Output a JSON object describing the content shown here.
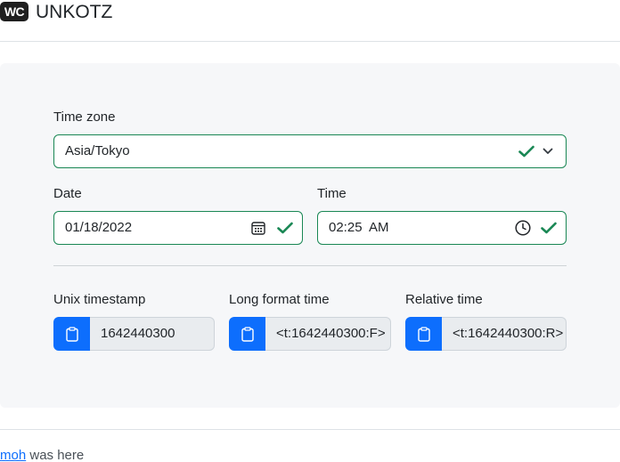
{
  "header": {
    "logo_text": "WC",
    "brand_name": "UNKOTZ"
  },
  "form": {
    "timezone": {
      "label": "Time zone",
      "value": "Asia/Tokyo"
    },
    "date": {
      "label": "Date",
      "value": "01/18/2022"
    },
    "time": {
      "label": "Time",
      "value": "02:25  AM"
    }
  },
  "outputs": [
    {
      "label": "Unix timestamp",
      "value": "1642440300"
    },
    {
      "label": "Long format time",
      "value": "<t:1642440300:F>"
    },
    {
      "label": "Relative time",
      "value": "<t:1642440300:R>"
    }
  ],
  "footer": {
    "author_link": "moh",
    "suffix": " was here"
  },
  "colors": {
    "valid": "#198754",
    "primary": "#0d6efd",
    "card_bg": "#f6f7f9"
  }
}
